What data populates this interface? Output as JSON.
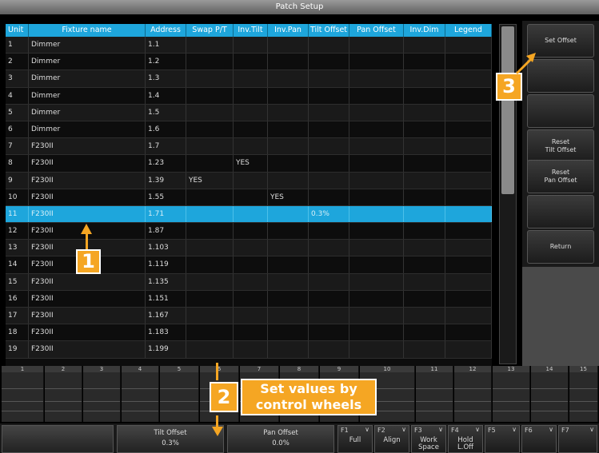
{
  "window": {
    "title": "Patch Setup"
  },
  "table": {
    "columns": [
      "Unit",
      "Fixture name",
      "Address",
      "Swap P/T",
      "Inv.Tilt",
      "Inv.Pan",
      "Tilt Offset",
      "Pan Offset",
      "Inv.Dim",
      "Legend"
    ],
    "rows": [
      [
        "1",
        "Dimmer",
        "1.1",
        "",
        "",
        "",
        "",
        "",
        "",
        ""
      ],
      [
        "2",
        "Dimmer",
        "1.2",
        "",
        "",
        "",
        "",
        "",
        "",
        ""
      ],
      [
        "3",
        "Dimmer",
        "1.3",
        "",
        "",
        "",
        "",
        "",
        "",
        ""
      ],
      [
        "4",
        "Dimmer",
        "1.4",
        "",
        "",
        "",
        "",
        "",
        "",
        ""
      ],
      [
        "5",
        "Dimmer",
        "1.5",
        "",
        "",
        "",
        "",
        "",
        "",
        ""
      ],
      [
        "6",
        "Dimmer",
        "1.6",
        "",
        "",
        "",
        "",
        "",
        "",
        ""
      ],
      [
        "7",
        "F230II",
        "1.7",
        "",
        "",
        "",
        "",
        "",
        "",
        ""
      ],
      [
        "8",
        "F230II",
        "1.23",
        "",
        "YES",
        "",
        "",
        "",
        "",
        ""
      ],
      [
        "9",
        "F230II",
        "1.39",
        "YES",
        "",
        "",
        "",
        "",
        "",
        ""
      ],
      [
        "10",
        "F230II",
        "1.55",
        "",
        "",
        "YES",
        "",
        "",
        "",
        ""
      ],
      [
        "11",
        "F230II",
        "1.71",
        "",
        "",
        "",
        "0.3%",
        "",
        "",
        ""
      ],
      [
        "12",
        "F230II",
        "1.87",
        "",
        "",
        "",
        "",
        "",
        "",
        ""
      ],
      [
        "13",
        "F230II",
        "1.103",
        "",
        "",
        "",
        "",
        "",
        "",
        ""
      ],
      [
        "14",
        "F230II",
        "1.119",
        "",
        "",
        "",
        "",
        "",
        "",
        ""
      ],
      [
        "15",
        "F230II",
        "1.135",
        "",
        "",
        "",
        "",
        "",
        "",
        ""
      ],
      [
        "16",
        "F230II",
        "1.151",
        "",
        "",
        "",
        "",
        "",
        "",
        ""
      ],
      [
        "17",
        "F230II",
        "1.167",
        "",
        "",
        "",
        "",
        "",
        "",
        ""
      ],
      [
        "18",
        "F230II",
        "1.183",
        "",
        "",
        "",
        "",
        "",
        "",
        ""
      ],
      [
        "19",
        "F230II",
        "1.199",
        "",
        "",
        "",
        "",
        "",
        "",
        ""
      ]
    ],
    "selected_row": "11"
  },
  "side_buttons": [
    {
      "label": "Set Offset"
    },
    {
      "label": ""
    },
    {
      "label": ""
    },
    {
      "label": "Reset\nTilt Offset"
    },
    {
      "label": "Reset\nPan Offset"
    },
    {
      "label": ""
    },
    {
      "label": "Return"
    }
  ],
  "wheels": {
    "numbers": [
      "1",
      "2",
      "3",
      "4",
      "5",
      "6",
      "7",
      "8",
      "9",
      "10",
      "11",
      "12",
      "13",
      "14",
      "15"
    ]
  },
  "bottom_bar": {
    "tilt_offset": {
      "label": "Tilt Offset",
      "value": "0.3%"
    },
    "pan_offset": {
      "label": "Pan Offset",
      "value": "0.0%"
    },
    "fkeys": [
      {
        "num": "F1",
        "label": "Full"
      },
      {
        "num": "F2",
        "label": "Align"
      },
      {
        "num": "F3",
        "label": "Work\nSpace"
      },
      {
        "num": "F4",
        "label": "Hold\nL.Off"
      },
      {
        "num": "F5",
        "label": ""
      },
      {
        "num": "F6",
        "label": ""
      },
      {
        "num": "F7",
        "label": ""
      }
    ]
  },
  "annotations": {
    "badge1": "1",
    "badge2": "2",
    "badge3": "3",
    "callout2": "Set values by\ncontrol wheels",
    "accent_color": "#f5a623",
    "selection_color": "#1ea6dc"
  }
}
